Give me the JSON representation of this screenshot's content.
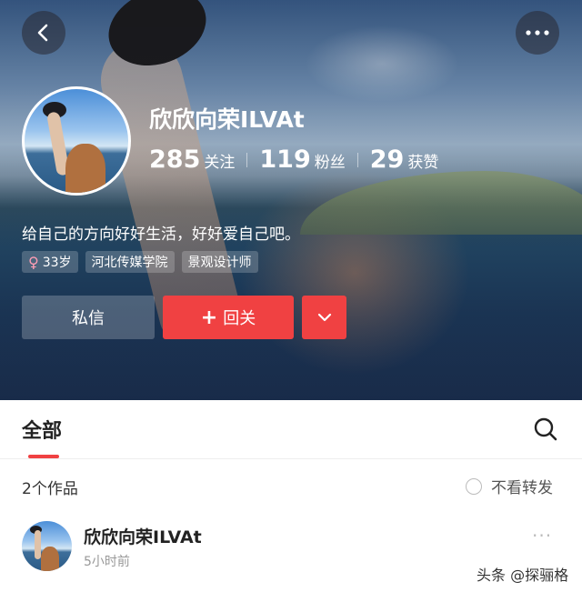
{
  "header": {
    "back_icon": "chevron-left-icon",
    "more_icon": "more-horizontal-icon"
  },
  "profile": {
    "username": "欣欣向荣ILVAt",
    "stats": [
      {
        "number": "285",
        "label": "关注"
      },
      {
        "number": "119",
        "label": "粉丝"
      },
      {
        "number": "29",
        "label": "获赞"
      }
    ],
    "bio": "给自己的方向好好生活，好好爱自己吧。",
    "tags": {
      "gender_icon": "female-icon",
      "gender_symbol": "♀",
      "age": "33岁",
      "school": "河北传媒学院",
      "occupation": "景观设计师"
    }
  },
  "actions": {
    "message_label": "私信",
    "follow_label": "回关",
    "follow_symbol": "+"
  },
  "tabs": {
    "all_label": "全部"
  },
  "works": {
    "count_label": "2个作品",
    "hide_reposts_label": "不看转发"
  },
  "post": {
    "author": "欣欣向荣ILVAt",
    "time": "5小时前",
    "more_symbol": "···"
  },
  "watermark": "头条 @探骊格",
  "colors": {
    "accent": "#f04142",
    "hero_dark": "#1d3c5c"
  }
}
